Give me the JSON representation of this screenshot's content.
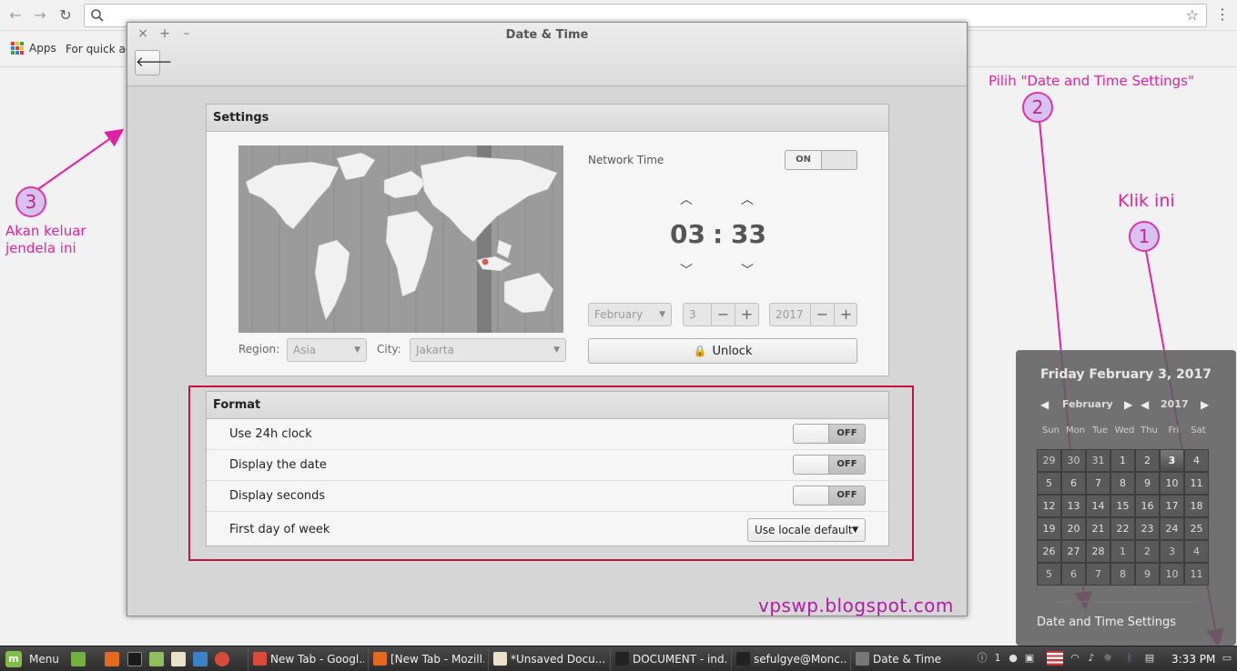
{
  "browser": {
    "bookmarks": {
      "apps_label": "Apps",
      "quick_label": "For quick ac"
    }
  },
  "annotations": {
    "step1_number": "1",
    "step1_text": "Klik ini",
    "step2_number": "2",
    "step2_text": "Pilih \"Date and Time Settings\"",
    "step3_number": "3",
    "step3_text_line1": "Akan keluar",
    "step3_text_line2": "jendela ini",
    "watermark": "vpswp.blogspot.com",
    "colors": {
      "accent": "#e31fa6",
      "highlight_box": "#c4143c"
    }
  },
  "dialog": {
    "title": "Date & Time",
    "window_buttons": {
      "close": "×",
      "maximize": "+",
      "minimize": "–"
    },
    "settings": {
      "header": "Settings",
      "region_label": "Region:",
      "region_value": "Asia",
      "city_label": "City:",
      "city_value": "Jakarta",
      "network_time_label": "Network Time",
      "network_time_state": "ON",
      "hours": "03",
      "separator": ":",
      "minutes": "33",
      "month": "February",
      "day": "3",
      "year": "2017",
      "unlock_label": "Unlock"
    },
    "format": {
      "header": "Format",
      "rows": [
        {
          "label": "Use 24h clock",
          "state": "OFF"
        },
        {
          "label": "Display the date",
          "state": "OFF"
        },
        {
          "label": "Display seconds",
          "state": "OFF"
        }
      ],
      "first_day_label": "First day of week",
      "first_day_value": "Use locale default"
    }
  },
  "calendar": {
    "heading": "Friday February 3, 2017",
    "month": "February",
    "year": "2017",
    "weekdays": [
      "Sun",
      "Mon",
      "Tue",
      "Wed",
      "Thu",
      "Fri",
      "Sat"
    ],
    "weeks": [
      [
        "29",
        "30",
        "31",
        "1",
        "2",
        "3",
        "4"
      ],
      [
        "5",
        "6",
        "7",
        "8",
        "9",
        "10",
        "11"
      ],
      [
        "12",
        "13",
        "14",
        "15",
        "16",
        "17",
        "18"
      ],
      [
        "19",
        "20",
        "21",
        "22",
        "23",
        "24",
        "25"
      ],
      [
        "26",
        "27",
        "28",
        "1",
        "2",
        "3",
        "4"
      ],
      [
        "5",
        "6",
        "7",
        "8",
        "9",
        "10",
        "11"
      ]
    ],
    "settings_link": "Date and Time Settings"
  },
  "taskbar": {
    "menu_label": "Menu",
    "tasks": [
      {
        "label": "New Tab - Googl...",
        "icon": "chrome-icon",
        "color": "#d94a38"
      },
      {
        "label": "[New Tab - Mozill...",
        "icon": "firefox-icon",
        "color": "#e66a1e"
      },
      {
        "label": "*Unsaved Docu...",
        "icon": "text-editor-icon",
        "color": "#e9e2c8"
      },
      {
        "label": "DOCUMENT - ind...",
        "icon": "document-icon",
        "color": "#222222"
      },
      {
        "label": "sefulgye@Monc...",
        "icon": "terminal-icon",
        "color": "#222222"
      },
      {
        "label": "Date & Time",
        "icon": "clock-settings-icon",
        "color": "#777777"
      }
    ],
    "tray_count": "1",
    "clock": "3:33 PM"
  }
}
